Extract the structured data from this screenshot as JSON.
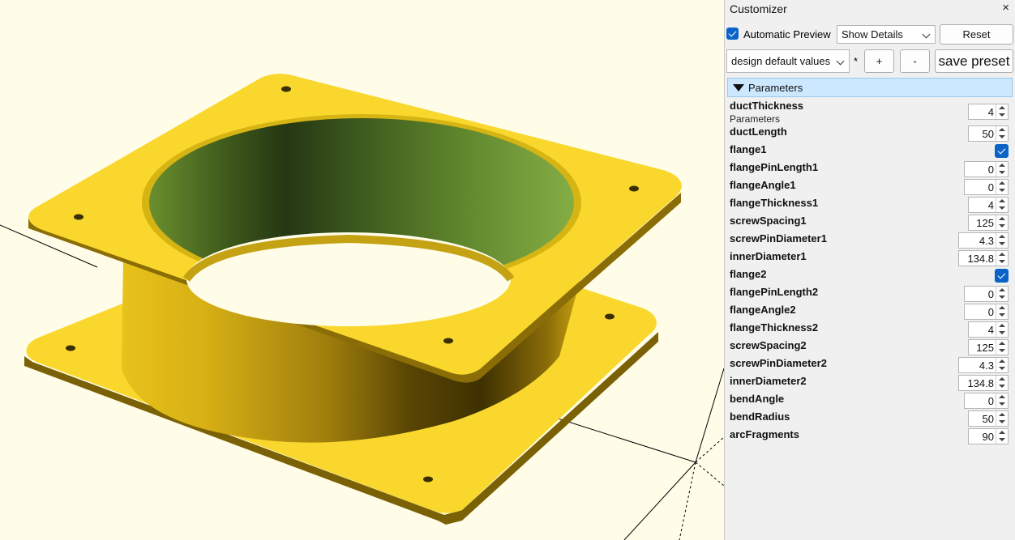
{
  "customizer": {
    "title": "Customizer",
    "close_icon": "×",
    "auto_preview_label": "Automatic Preview",
    "auto_preview_checked": true,
    "details_select": "Show Details",
    "reset_label": "Reset",
    "preset_select": "design default values",
    "modified_marker": "*",
    "add_label": "+",
    "remove_label": "-",
    "save_preset_label": "save preset"
  },
  "parameters": {
    "group_label": "Parameters",
    "first_description": "Parameters",
    "items": [
      {
        "name": "ductThickness",
        "value": "4"
      },
      {
        "name": "ductLength",
        "value": "50"
      },
      {
        "name": "flange1",
        "checked": true
      },
      {
        "name": "flangePinLength1",
        "value": "0"
      },
      {
        "name": "flangeAngle1",
        "value": "0"
      },
      {
        "name": "flangeThickness1",
        "value": "4"
      },
      {
        "name": "screwSpacing1",
        "value": "125"
      },
      {
        "name": "screwPinDiameter1",
        "value": "4.3"
      },
      {
        "name": "innerDiameter1",
        "value": "134.8"
      },
      {
        "name": "flange2",
        "checked": true
      },
      {
        "name": "flangePinLength2",
        "value": "0"
      },
      {
        "name": "flangeAngle2",
        "value": "0"
      },
      {
        "name": "flangeThickness2",
        "value": "4"
      },
      {
        "name": "screwSpacing2",
        "value": "125"
      },
      {
        "name": "screwPinDiameter2",
        "value": "4.3"
      },
      {
        "name": "innerDiameter2",
        "value": "134.8"
      },
      {
        "name": "bendAngle",
        "value": "0"
      },
      {
        "name": "bendRadius",
        "value": "50"
      },
      {
        "name": "arcFragments",
        "value": "90"
      }
    ]
  },
  "colors": {
    "model_yellow": "#f9d72c",
    "viewport_bg": "#fffde8",
    "accent_blue": "#0a64c8",
    "group_header_bg": "#cce8ff"
  }
}
